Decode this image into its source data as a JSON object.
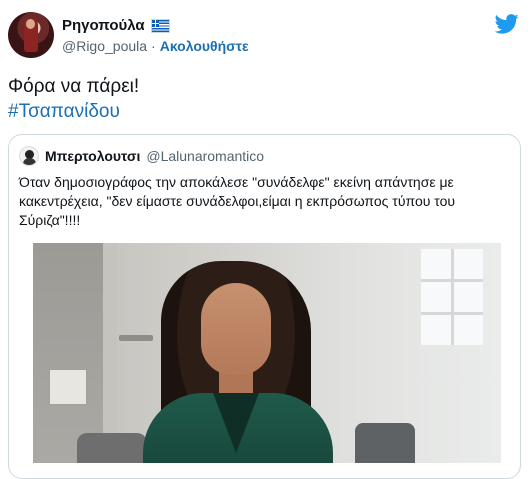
{
  "tweet": {
    "author": {
      "display_name": "Ρηγοπούλα",
      "handle": "@Rigo_poula",
      "separator": "·",
      "follow_label": "Ακολουθήστε",
      "flag_icon": "greece-flag-icon"
    },
    "text": "Φόρα να πάρει!",
    "hashtag": "#Τσαπανίδου",
    "brand_icon": "twitter-bird-icon",
    "colors": {
      "link": "#1b6fb3",
      "brand": "#1d9bf0",
      "muted": "#536471",
      "border": "#cfd9de"
    }
  },
  "quoted_tweet": {
    "display_name": "Μπερτολουτσι",
    "handle": "@Lalunaromantico",
    "text": "Όταν δημοσιογράφος την αποκάλεσε \"συνάδελφε\" εκείνη απάντησε με κακεντρέχεια, \"δεν είμαστε συνάδελφοι,είμαι η εκπρόσωπος τύπου του Σύριζα\"!!!!",
    "media": "photo"
  }
}
